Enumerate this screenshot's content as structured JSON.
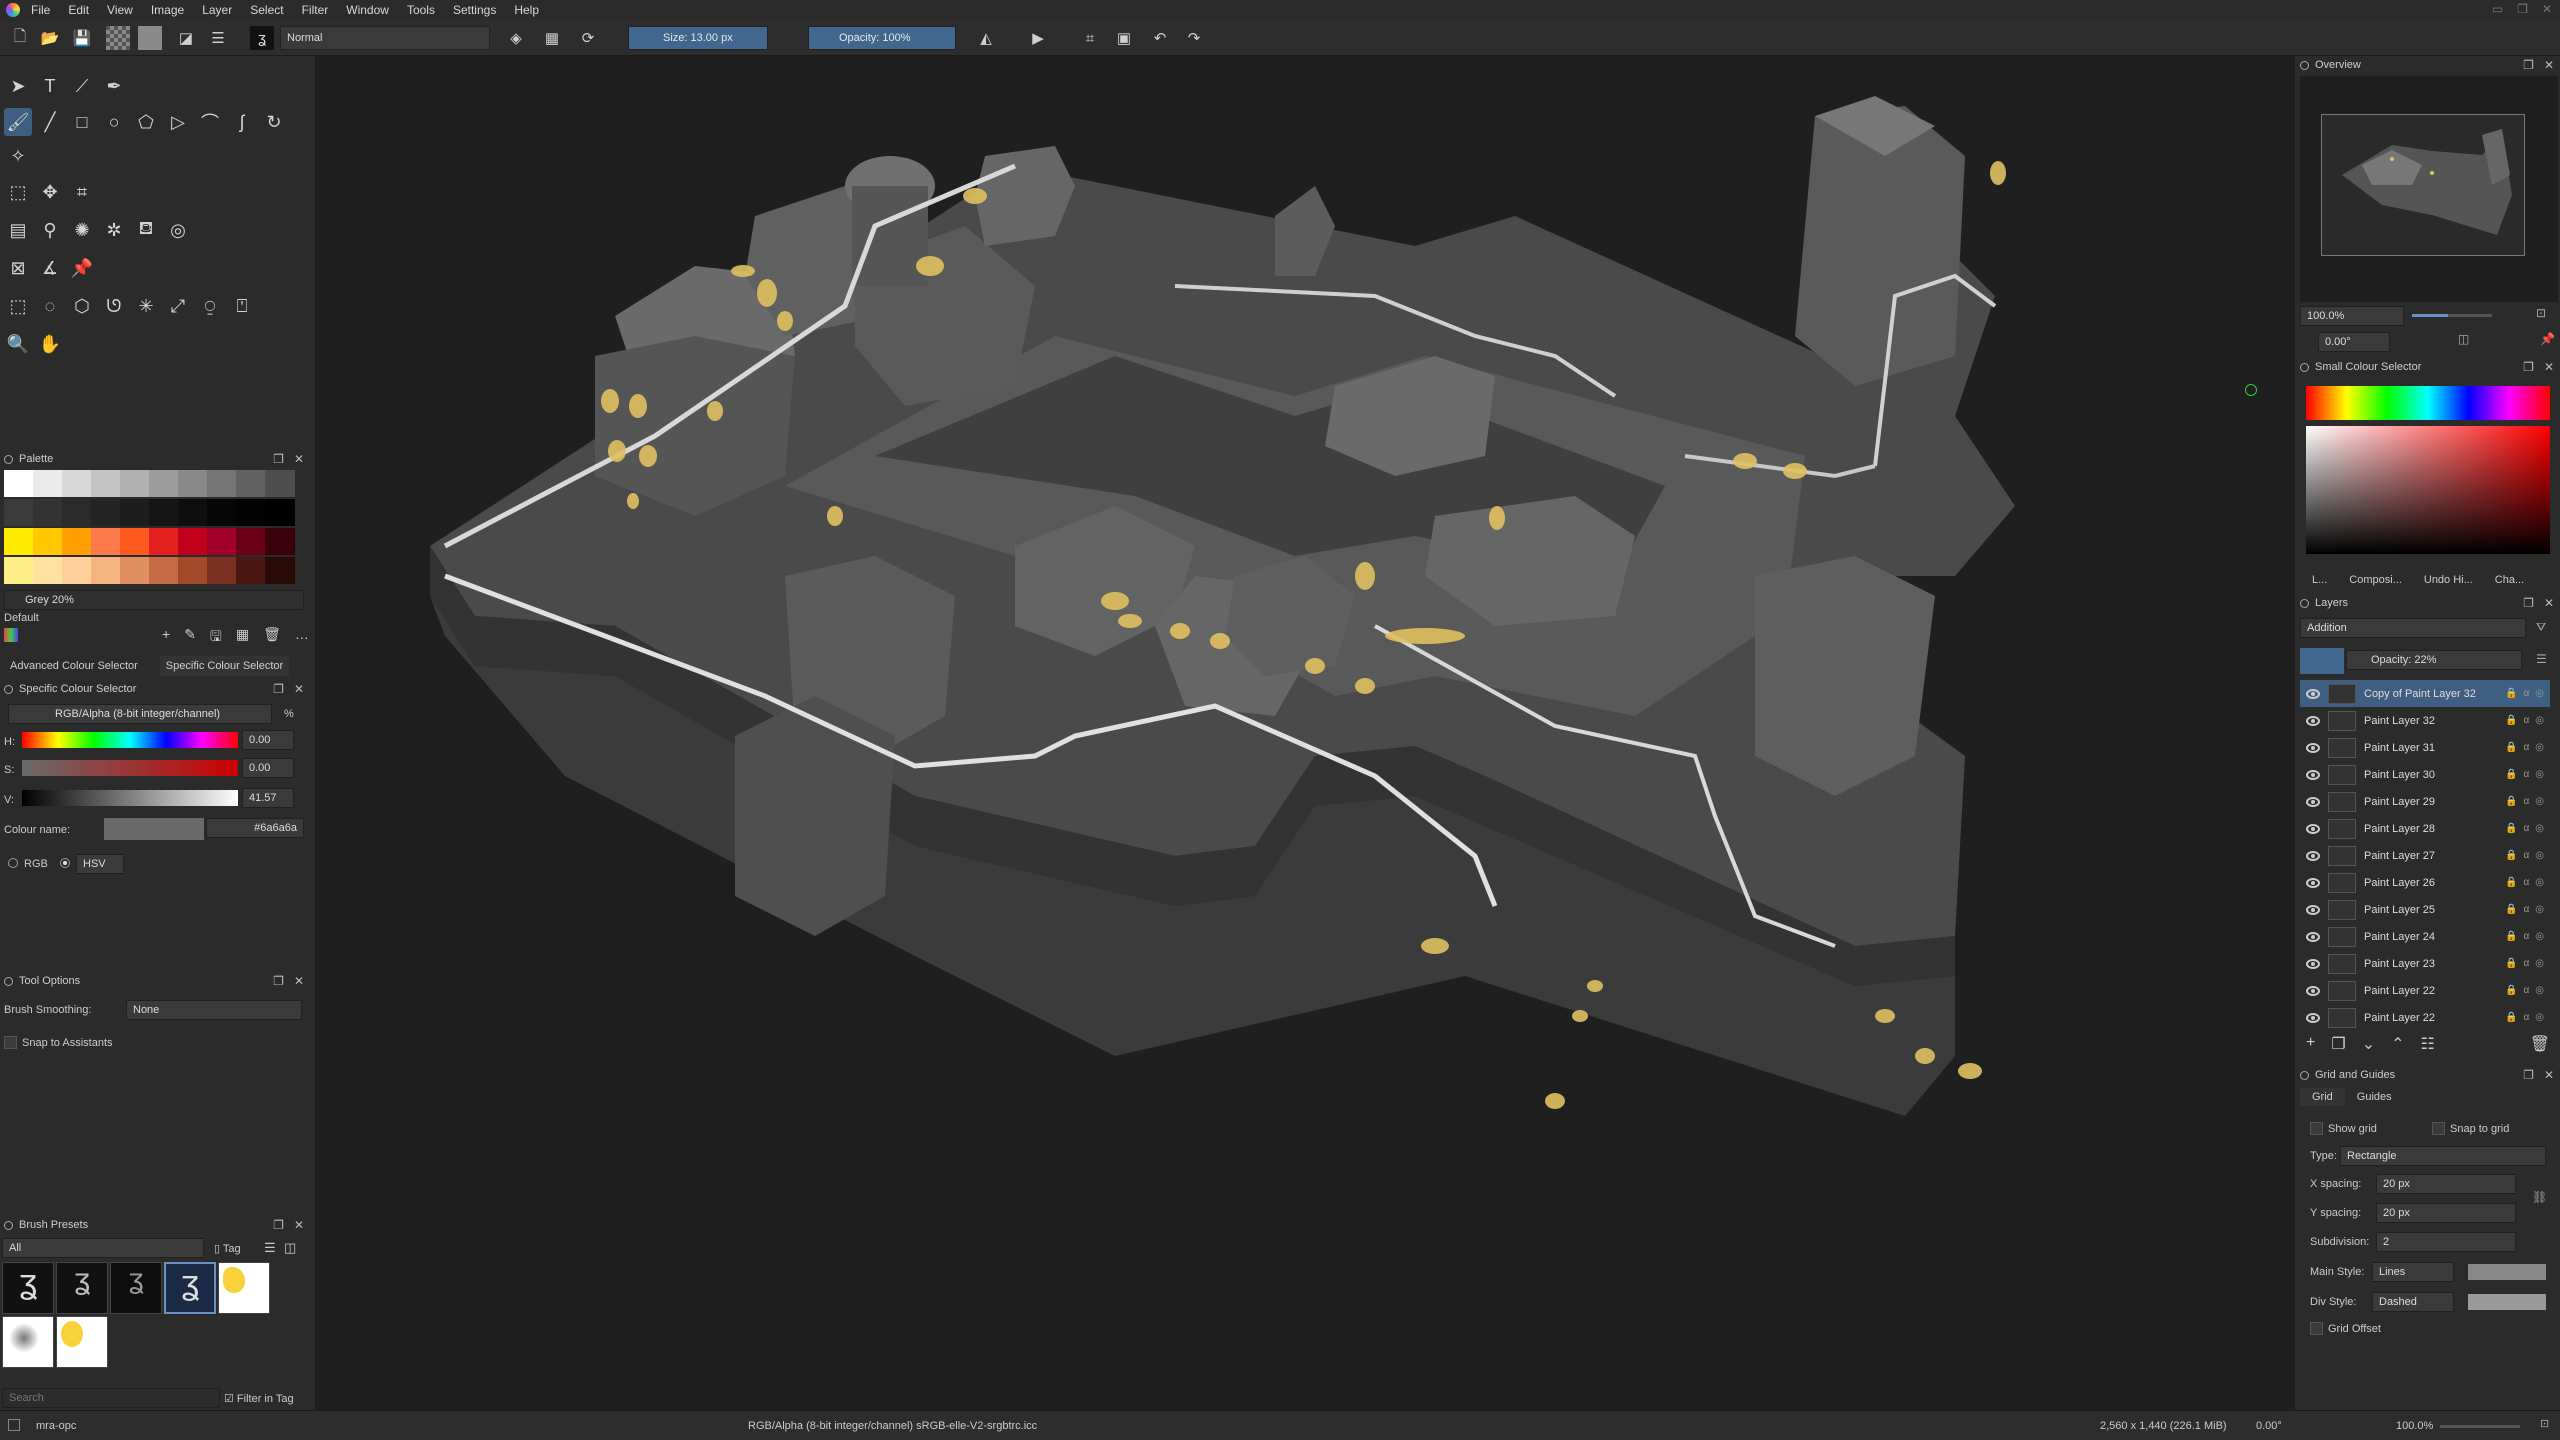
{
  "menu": {
    "items": [
      "File",
      "Edit",
      "View",
      "Image",
      "Layer",
      "Select",
      "Filter",
      "Window",
      "Tools",
      "Settings",
      "Help"
    ]
  },
  "toolbar": {
    "blend_mode": "Normal",
    "size": "Size: 13.00 px",
    "opacity": "Opacity: 100%"
  },
  "palette": {
    "title": "Palette",
    "selected_name": "Grey 20%",
    "set_name": "Default",
    "rows": [
      [
        "#ffffff",
        "#ebebeb",
        "#d8d8d8",
        "#c4c4c4",
        "#b0b0b0",
        "#9c9c9c",
        "#898989",
        "#757575",
        "#616161",
        "#4e4e4e"
      ],
      [
        "#3a3a3a",
        "#333333",
        "#2b2b2b",
        "#242424",
        "#1d1d1d",
        "#151515",
        "#0e0e0e",
        "#070707",
        "#030303",
        "#000000"
      ],
      [
        "#ffeb00",
        "#ffc800",
        "#ff9f00",
        "#ff7a4a",
        "#ff5a1e",
        "#e32020",
        "#c0001a",
        "#a0002a",
        "#6a0018",
        "#3a000c"
      ],
      [
        "#ffef88",
        "#ffe2a0",
        "#ffcf9c",
        "#f4b47e",
        "#e09060",
        "#c46a44",
        "#a04a2a",
        "#7a3020",
        "#4a1810",
        "#2a0a06"
      ]
    ]
  },
  "colour_tabs": [
    "Advanced Colour Selector",
    "Specific Colour Selector"
  ],
  "specific_colour": {
    "title": "Specific Colour Selector",
    "model": "RGB/Alpha (8-bit integer/channel)",
    "h_label": "H:",
    "h_value": "0.00",
    "s_label": "S:",
    "s_value": "0.00",
    "v_label": "V:",
    "v_value": "41.57",
    "colour_name_label": "Colour name:",
    "hex": "#6a6a6a",
    "rgb": "RGB",
    "hsv": "HSV",
    "percent": "%"
  },
  "tool_options": {
    "title": "Tool Options",
    "smoothing_label": "Brush Smoothing:",
    "smoothing_value": "None",
    "snap_label": "Snap to Assistants"
  },
  "brush_presets": {
    "title": "Brush Presets",
    "filter": "All",
    "tag": "Tag",
    "search_placeholder": "Search",
    "filter_in_tag": "Filter in Tag"
  },
  "overview": {
    "title": "Overview",
    "zoom": "100.0%",
    "rotation": "0.00°"
  },
  "small_colour": {
    "title": "Small Colour Selector"
  },
  "tabs": [
    "L...",
    "Composi...",
    "Undo Hi...",
    "Cha..."
  ],
  "layers": {
    "title": "Layers",
    "blend": "Addition",
    "opacity": "Opacity:  22%",
    "items": [
      "Copy of Paint Layer 32",
      "Paint Layer 32",
      "Paint Layer 31",
      "Paint Layer 30",
      "Paint Layer 29",
      "Paint Layer 28",
      "Paint Layer 27",
      "Paint Layer 26",
      "Paint Layer 25",
      "Paint Layer 24",
      "Paint Layer 23",
      "Paint Layer 22",
      "Paint Layer 22"
    ]
  },
  "grid": {
    "title": "Grid and Guides",
    "tabs": [
      "Grid",
      "Guides"
    ],
    "show_grid": "Show grid",
    "snap_grid": "Snap to grid",
    "type_label": "Type:",
    "type_value": "Rectangle",
    "xs_label": "X spacing:",
    "xs_value": "20 px",
    "ys_label": "Y spacing:",
    "ys_value": "20 px",
    "sub_label": "Subdivision:",
    "sub_value": "2",
    "main_label": "Main Style:",
    "main_value": "Lines",
    "div_label": "Div Style:",
    "div_value": "Dashed",
    "offset": "Grid Offset"
  },
  "status": {
    "file": "mra-opc",
    "colorspace": "RGB/Alpha (8-bit integer/channel)  sRGB-elle-V2-srgbtrc.icc",
    "dims": "2,560 x 1,440 (226.1 MiB)",
    "angle": "0.00°",
    "zoom": "100.0%"
  }
}
